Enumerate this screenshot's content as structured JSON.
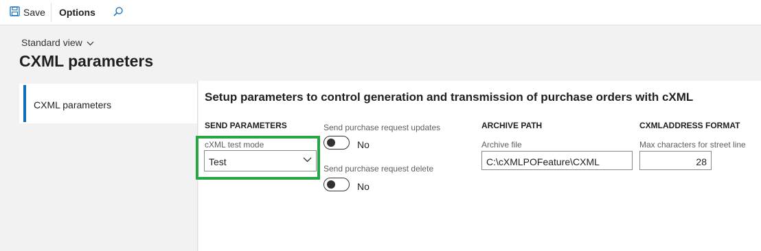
{
  "actionbar": {
    "save_label": "Save",
    "options_label": "Options",
    "save_icon": "floppy-disk-icon",
    "search_icon": "search-icon"
  },
  "header": {
    "view_selector": "Standard view",
    "title": "CXML parameters"
  },
  "nav": {
    "items": [
      {
        "label": "CXML parameters",
        "selected": true
      }
    ]
  },
  "main": {
    "section_title": "Setup parameters to control generation and transmission of purchase orders with cXML",
    "send_parameters": {
      "heading": "SEND PARAMETERS",
      "test_mode_label": "cXML test mode",
      "test_mode_value": "Test"
    },
    "toggles": [
      {
        "label": "Send purchase request updates",
        "state": "No"
      },
      {
        "label": "Send purchase request delete",
        "state": "No"
      }
    ],
    "archive_path": {
      "heading": "ARCHIVE PATH",
      "field_label": "Archive file",
      "value": "C:\\cXMLPOFeature\\CXML"
    },
    "address_format": {
      "heading": "CXMLADDRESS FORMAT",
      "field_label": "Max characters for street line",
      "value": "28"
    }
  },
  "colors": {
    "accent": "#0f6cbd",
    "highlight": "#27a744"
  }
}
